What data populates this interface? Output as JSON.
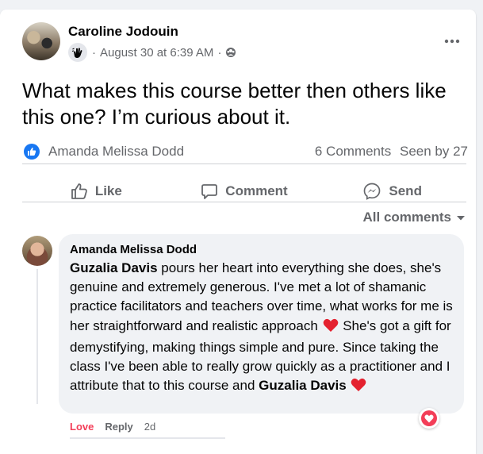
{
  "post": {
    "author": "Caroline Jodouin",
    "date": "August 30 at 6:39 AM",
    "separator": "·",
    "text": "What makes this course better then others like this one? I’m curious about it.",
    "liked_by": "Amanda Melissa Dodd",
    "comments_count": "6 Comments",
    "seen_by": "Seen by 27"
  },
  "actions": {
    "like": "Like",
    "comment": "Comment",
    "send": "Send"
  },
  "filter": {
    "label": "All comments"
  },
  "comment": {
    "author": "Amanda Melissa Dodd",
    "mention": "Guzalia Davis",
    "text_1": " pours her heart into everything she does, she's genuine and extremely generous. I've met a lot of shamanic practice facilitators and teachers over time, what works for me is her straightforward and realistic approach ",
    "text_2": " She's got a gift for demystifying, making things simple and pure. Since taking the class I've been able to really grow quickly as a practitioner and I attribute that to this course and ",
    "reaction_label": "Love",
    "reply_label": "Reply",
    "time": "2d"
  },
  "icons": {
    "more": "more-options-icon",
    "badge": "hand-wave-icon",
    "privacy": "group-privacy-icon",
    "like": "thumbs-up-icon",
    "comment": "comment-bubble-icon",
    "send": "messenger-send-icon",
    "caret": "caret-down-icon",
    "heart": "red-heart-icon",
    "reaction": "love-reaction-icon"
  },
  "colors": {
    "accent": "#1877f2",
    "love": "#f33e58",
    "secondary_text": "#65676b"
  }
}
